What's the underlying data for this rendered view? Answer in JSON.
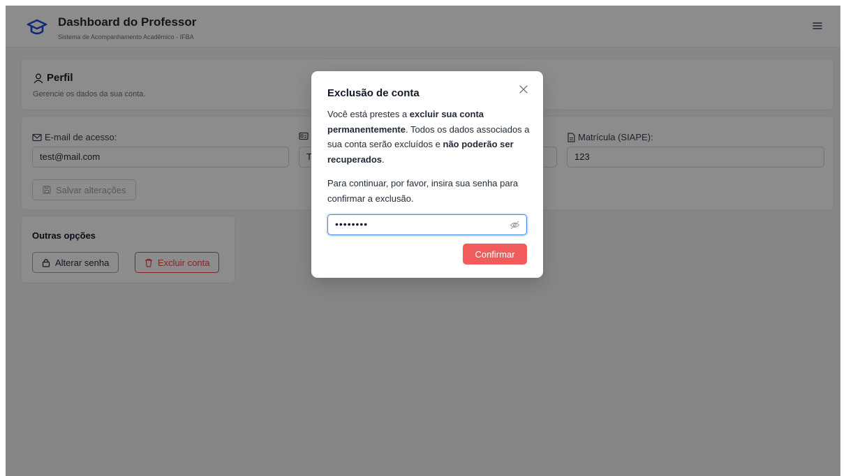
{
  "header": {
    "title": "Dashboard do Professor",
    "subtitle": "Sistema de Acompanhamento Acadêmico - IFBA",
    "logo_icon": "graduation-cap-icon",
    "menu_icon": "menu-icon",
    "brand_color": "#1d4ed8"
  },
  "profile": {
    "title": "Perfil",
    "description": "Gerencie os dados da sua conta."
  },
  "form": {
    "email_label": "E-mail de acesso:",
    "email_value": "test@mail.com",
    "name_value": "T",
    "matricula_label": "Matrícula (SIAPE):",
    "matricula_value": "123",
    "save_label": "Salvar alterações"
  },
  "options": {
    "title": "Outras opções",
    "change_password_label": "Alterar senha",
    "delete_account_label": "Excluir conta"
  },
  "modal": {
    "title": "Exclusão de conta",
    "text_1": "Você está prestes a ",
    "text_bold_1": "excluir sua conta permanentemente",
    "text_2": ". Todos os dados associados a sua conta serão excluídos e ",
    "text_bold_2": "não poderão ser recuperados",
    "text_3": ".",
    "instruction": "Para continuar, por favor, insira sua senha para confirmar a exclusão.",
    "password_masked": "••••••••",
    "confirm_label": "Confirmar",
    "danger_color": "#f15b5b",
    "focus_color": "#3b82f6"
  }
}
